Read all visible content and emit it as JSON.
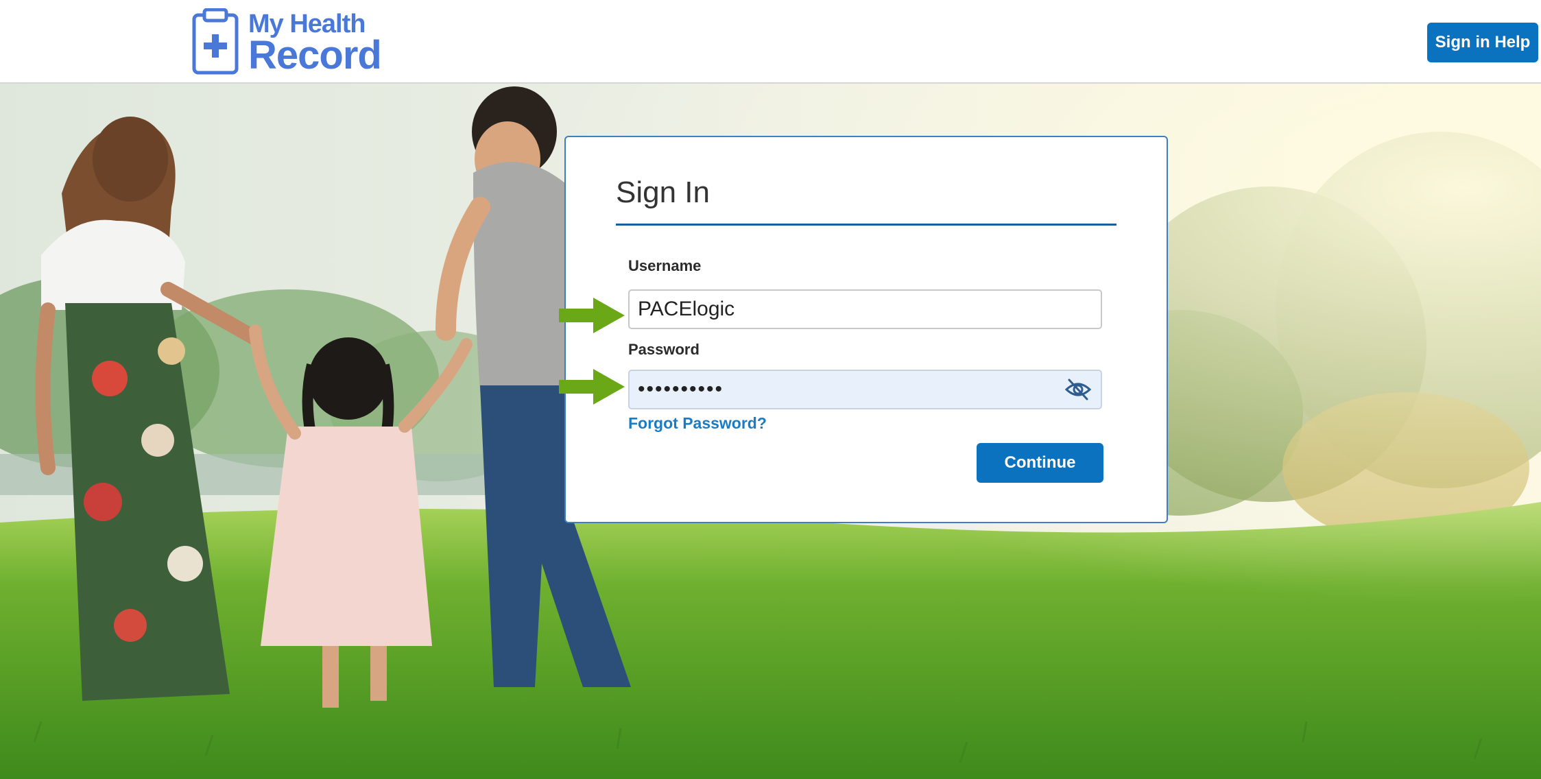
{
  "header": {
    "logo": {
      "line1": "My Health",
      "line2": "Record",
      "icon": "clipboard-plus-icon"
    },
    "help_button_label": "Sign in Help"
  },
  "signin": {
    "title": "Sign In",
    "username_label": "Username",
    "username_value": "PACElogic",
    "password_label": "Password",
    "password_value": "••••••••••",
    "toggle_visibility_icon": "eye-slash-icon",
    "forgot_password_label": "Forgot Password?",
    "continue_label": "Continue"
  },
  "annotations": {
    "arrow_icon": "arrow-right-icon",
    "arrow_color": "#6aa817"
  },
  "colors": {
    "brand_blue": "#0b72bf",
    "logo_blue": "#4a78d8",
    "link_blue": "#1b7bc4",
    "card_border": "#3e7ec2"
  },
  "background": {
    "scene": "family-walking-on-grass-photo"
  }
}
